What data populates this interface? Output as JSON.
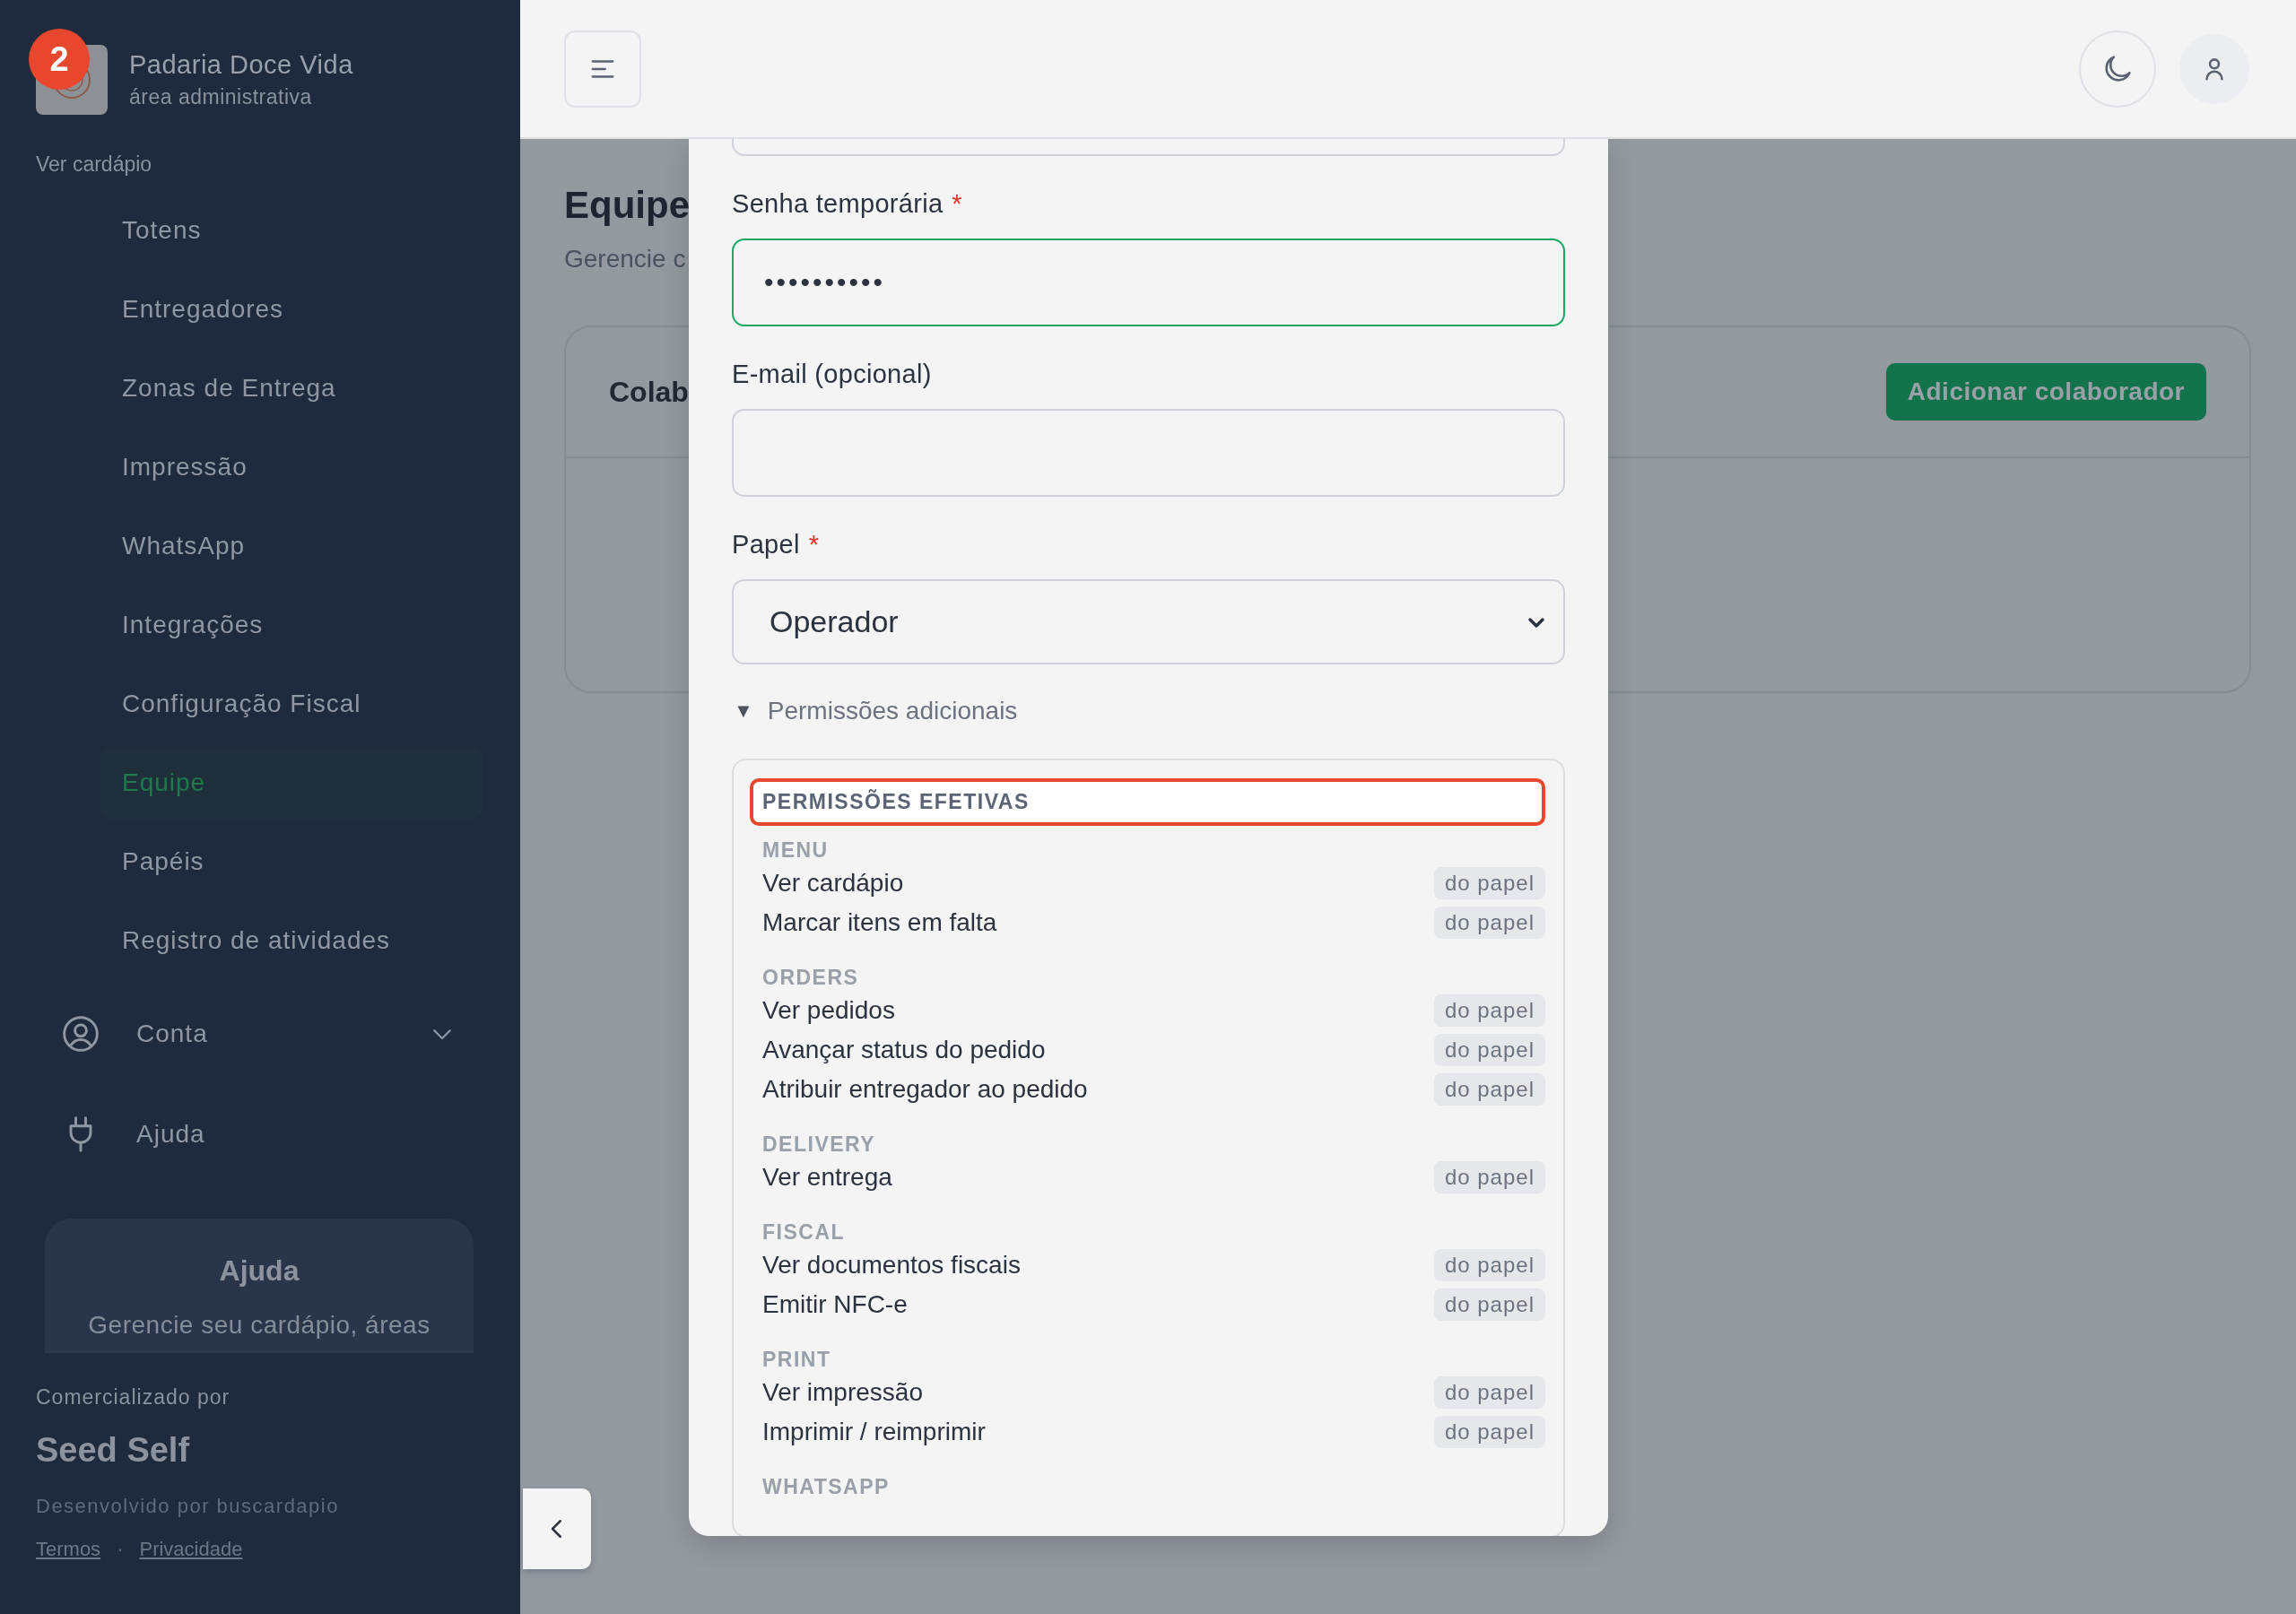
{
  "sidebar": {
    "brand": {
      "title": "Padaria Doce Vida",
      "subtitle": "área administrativa"
    },
    "badge": "2",
    "menu_link": "Ver cardápio",
    "items": [
      {
        "label": "Totens",
        "selected": false
      },
      {
        "label": "Entregadores",
        "selected": false
      },
      {
        "label": "Zonas de Entrega",
        "selected": false
      },
      {
        "label": "Impressão",
        "selected": false
      },
      {
        "label": "WhatsApp",
        "selected": false
      },
      {
        "label": "Integrações",
        "selected": false
      },
      {
        "label": "Configuração Fiscal",
        "selected": false
      },
      {
        "label": "Equipe",
        "selected": true
      },
      {
        "label": "Papéis",
        "selected": false
      },
      {
        "label": "Registro de atividades",
        "selected": false
      }
    ],
    "account": {
      "label": "Conta",
      "expanded": false
    },
    "help_link": "Ajuda",
    "help_card": {
      "title": "Ajuda",
      "text": "Gerencie seu cardápio, áreas"
    },
    "footer": {
      "caption": "Comercializado por",
      "brand": "Seed Self",
      "credit": "Desenvolvido por buscardapio",
      "links": [
        "Termos",
        "Privacidade"
      ],
      "separator": "·"
    }
  },
  "page": {
    "title": "Equipe",
    "subtitle": "Gerencie c",
    "card_title": "Colab",
    "add_button": "Adicionar colaborador"
  },
  "modal": {
    "fields": [
      {
        "kind": "partial"
      },
      {
        "kind": "password",
        "label": "Senha temporária",
        "required_mark": "*",
        "value": "••••••••••",
        "focused": true
      },
      {
        "kind": "text",
        "label": "E-mail (opcional)",
        "focused": false
      },
      {
        "kind": "select",
        "label": "Papel",
        "required_mark": "*",
        "value": "Operador",
        "focused": false
      }
    ],
    "disclosure": {
      "marker": "▼",
      "label": "Permissões adicionais",
      "expanded": true
    },
    "permissions": {
      "title": "PERMISSÕES EFETIVAS",
      "highlighted": true,
      "groups": [
        {
          "name": "MENU",
          "rows": [
            {
              "label": "Ver cardápio",
              "source": "do papel"
            },
            {
              "label": "Marcar itens em falta",
              "source": "do papel"
            }
          ]
        },
        {
          "name": "ORDERS",
          "rows": [
            {
              "label": "Ver pedidos",
              "source": "do papel"
            },
            {
              "label": "Avançar status do pedido",
              "source": "do papel"
            },
            {
              "label": "Atribuir entregador ao pedido",
              "source": "do papel"
            }
          ]
        },
        {
          "name": "DELIVERY",
          "rows": [
            {
              "label": "Ver entrega",
              "source": "do papel"
            }
          ]
        },
        {
          "name": "FISCAL",
          "rows": [
            {
              "label": "Ver documentos fiscais",
              "source": "do papel"
            },
            {
              "label": "Emitir NFC-e",
              "source": "do papel"
            }
          ]
        },
        {
          "name": "PRINT",
          "rows": [
            {
              "label": "Ver impressão",
              "source": "do papel"
            },
            {
              "label": "Imprimir / reimprimir",
              "source": "do papel"
            }
          ]
        },
        {
          "name": "WHATSAPP"
        }
      ]
    }
  }
}
